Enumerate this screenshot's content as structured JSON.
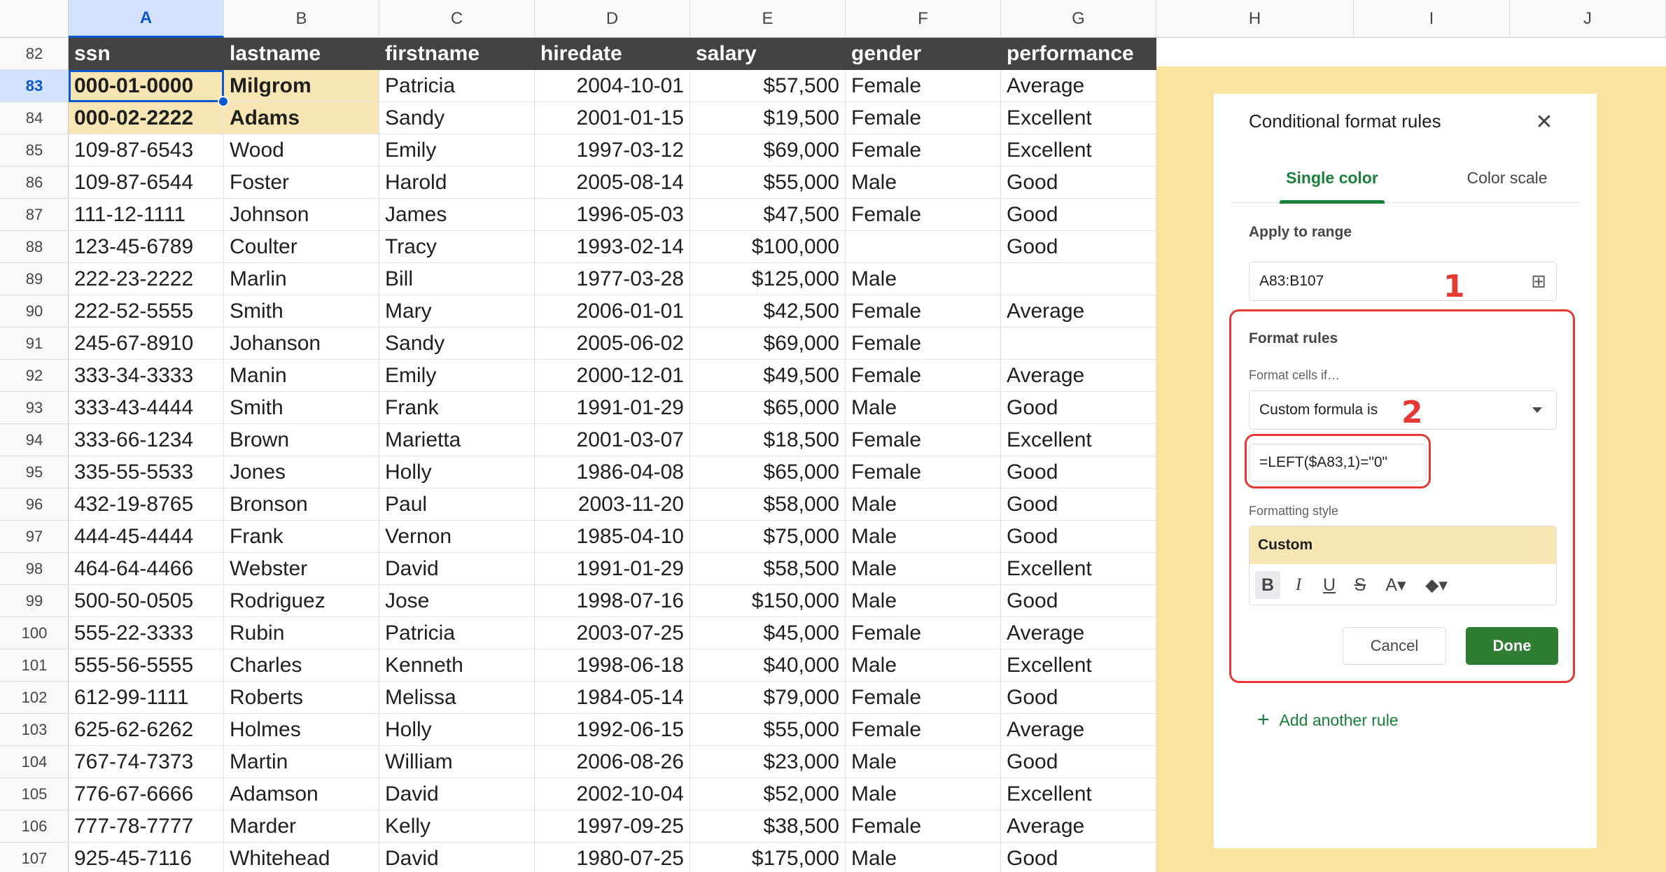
{
  "columns": [
    "A",
    "B",
    "C",
    "D",
    "E",
    "F",
    "G",
    "H",
    "I",
    "J"
  ],
  "row_numbers": [
    "82",
    "83",
    "84",
    "85",
    "86",
    "87",
    "88",
    "89",
    "90",
    "91",
    "92",
    "93",
    "94",
    "95",
    "96",
    "97",
    "98",
    "99",
    "100",
    "101",
    "102",
    "103",
    "104",
    "105",
    "106",
    "107"
  ],
  "header_row": [
    "ssn",
    "lastname",
    "firstname",
    "hiredate",
    "salary",
    "gender",
    "performance"
  ],
  "rows": [
    [
      "000-01-0000",
      "Milgrom",
      "Patricia",
      "2004-10-01",
      "$57,500",
      "Female",
      "Average"
    ],
    [
      "000-02-2222",
      "Adams",
      "Sandy",
      "2001-01-15",
      "$19,500",
      "Female",
      "Excellent"
    ],
    [
      "109-87-6543",
      "Wood",
      "Emily",
      "1997-03-12",
      "$69,000",
      "Female",
      "Excellent"
    ],
    [
      "109-87-6544",
      "Foster",
      "Harold",
      "2005-08-14",
      "$55,000",
      "Male",
      "Good"
    ],
    [
      "111-12-1111",
      "Johnson",
      "James",
      "1996-05-03",
      "$47,500",
      "Female",
      "Good"
    ],
    [
      "123-45-6789",
      "Coulter",
      "Tracy",
      "1993-02-14",
      "$100,000",
      "",
      "Good"
    ],
    [
      "222-23-2222",
      "Marlin",
      "Bill",
      "1977-03-28",
      "$125,000",
      "Male",
      ""
    ],
    [
      "222-52-5555",
      "Smith",
      "Mary",
      "2006-01-01",
      "$42,500",
      "Female",
      "Average"
    ],
    [
      "245-67-8910",
      "Johanson",
      "Sandy",
      "2005-06-02",
      "$69,000",
      "Female",
      ""
    ],
    [
      "333-34-3333",
      "Manin",
      "Emily",
      "2000-12-01",
      "$49,500",
      "Female",
      "Average"
    ],
    [
      "333-43-4444",
      "Smith",
      "Frank",
      "1991-01-29",
      "$65,000",
      "Male",
      "Good"
    ],
    [
      "333-66-1234",
      "Brown",
      "Marietta",
      "2001-03-07",
      "$18,500",
      "Female",
      "Excellent"
    ],
    [
      "335-55-5533",
      "Jones",
      "Holly",
      "1986-04-08",
      "$65,000",
      "Female",
      "Good"
    ],
    [
      "432-19-8765",
      "Bronson",
      "Paul",
      "2003-11-20",
      "$58,000",
      "Male",
      "Good"
    ],
    [
      "444-45-4444",
      "Frank",
      "Vernon",
      "1985-04-10",
      "$75,000",
      "Male",
      "Good"
    ],
    [
      "464-64-4466",
      "Webster",
      "David",
      "1991-01-29",
      "$58,500",
      "Male",
      "Excellent"
    ],
    [
      "500-50-0505",
      "Rodriguez",
      "Jose",
      "1998-07-16",
      "$150,000",
      "Male",
      "Good"
    ],
    [
      "555-22-3333",
      "Rubin",
      "Patricia",
      "2003-07-25",
      "$45,000",
      "Female",
      "Average"
    ],
    [
      "555-56-5555",
      "Charles",
      "Kenneth",
      "1998-06-18",
      "$40,000",
      "Male",
      "Excellent"
    ],
    [
      "612-99-1111",
      "Roberts",
      "Melissa",
      "1984-05-14",
      "$79,000",
      "Female",
      "Good"
    ],
    [
      "625-62-6262",
      "Holmes",
      "Holly",
      "1992-06-15",
      "$55,000",
      "Female",
      "Average"
    ],
    [
      "767-74-7373",
      "Martin",
      "William",
      "2006-08-26",
      "$23,000",
      "Male",
      "Good"
    ],
    [
      "776-67-6666",
      "Adamson",
      "David",
      "2002-10-04",
      "$52,000",
      "Male",
      "Excellent"
    ],
    [
      "777-78-7777",
      "Marder",
      "Kelly",
      "1997-09-25",
      "$38,500",
      "Female",
      "Average"
    ],
    [
      "925-45-7116",
      "Whitehead",
      "David",
      "1980-07-25",
      "$175,000",
      "Male",
      "Good"
    ]
  ],
  "panel": {
    "title": "Conditional format rules",
    "close_icon": "close-icon",
    "tab_single": "Single color",
    "tab_scale": "Color scale",
    "apply_label": "Apply to range",
    "range_value": "A83:B107",
    "format_rules_label": "Format rules",
    "format_cells_if": "Format cells if…",
    "condition_value": "Custom formula is",
    "formula_value": "=LEFT($A83,1)=\"0\"",
    "formatting_style_label": "Formatting style",
    "style_preview": "Custom",
    "cancel_label": "Cancel",
    "done_label": "Done",
    "add_rule_label": "Add another rule"
  },
  "annotations": {
    "one": "1",
    "two": "2"
  },
  "colors": {
    "accent_green": "#188038",
    "done_button": "#2e7d32",
    "highlight_fill": "#f7e6b3",
    "annotation_red": "#e53935",
    "selection_blue": "#0b57d0",
    "header_dark": "#434343"
  }
}
